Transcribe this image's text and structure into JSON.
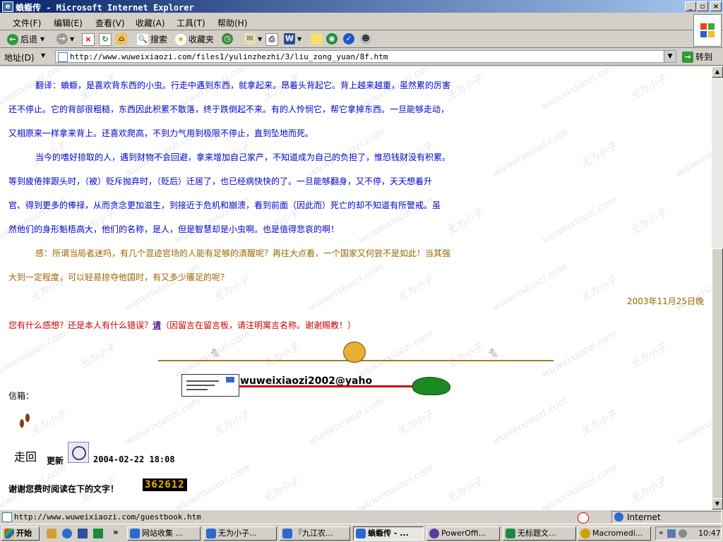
{
  "window": {
    "title": "蝜蝂传 - Microsoft Internet Explorer"
  },
  "menu": [
    "文件(F)",
    "编辑(E)",
    "查看(V)",
    "收藏(A)",
    "工具(T)",
    "帮助(H)"
  ],
  "toolbar": {
    "back": "后退",
    "search": "搜索",
    "favorites": "收藏夹"
  },
  "address": {
    "label": "地址(D)",
    "url": "http://www.wuweixiaozi.com/files1/yulinzhezhi/3/liu_zong_yuan/8f.htm",
    "go": "转到"
  },
  "article": {
    "lines_blue": [
      "翻译：蝜蝂，是喜欢背东西的小虫。行走中遇到东西，就拿起来。昂着头背起它。背上越来越重，虽然累的厉害",
      "还不停止。它的背部很粗糙，东西因此积累不散落，终于跌倒起不来。有的人怜悯它，帮它拿掉东西。一旦能够走动，",
      "又相原来一样拿来背上。还喜欢爬高，不到力气用到极限不停止，直到坠地而死。",
      "当今的嗜好掠取的人，遇到财物不会回避，拿来增加自己家产，不知道成为自己的负担了，惟恐钱财没有积累。",
      "等到疲倦摔跟头时，（被）贬斥抛弃时，（贬后）迁居了，也已经病快快的了。一旦能够翻身，又不停，天天想着升",
      "官、得到更多的俸禄，从而贪念更加滋生，到接近于危机和崩溃，看到前面（因此而）死亡的却不知道有所警戒。虽",
      "然他们的身形魁梧高大，他们的名称，是人，但是智慧却是小虫啊。也是值得悲哀的啊！"
    ],
    "lines_gold": [
      "感：所谓当局者迷吗，有几个混迹官场的人能有足够的清醒呢？再往大点看，一个国家又何尝不是如此！当其强",
      "大到一定程度，可以轻易掠夺他国时，有又多少餍足的呢？"
    ],
    "date": "2003年11月25日晚"
  },
  "feedback": {
    "question": "您有什么感想？还是本人有什么错误？",
    "link": "请",
    "note": "（因留言在留言板，请注明寓言名称。谢谢赐教！）"
  },
  "mailbox": {
    "label": "信箱：",
    "email": "wuweixiaozi2002@yaho"
  },
  "footer": {
    "zou_label": "走回",
    "update_label": "更新",
    "updated": "2004-02-22 18:08",
    "thanks": "谢谢您费时阅读在下的文字！",
    "counter": "362612"
  },
  "watermark": "wuweixiaozi.com",
  "watermark_cn": "无为小子",
  "status": {
    "url": "http://www.wuweixiaozi.com/guestbook.htm",
    "zone": "Internet"
  },
  "taskbar": {
    "start": "开始",
    "items": [
      "网站收集 ...",
      "无为小子...",
      "『九江农...",
      "蝜蝂传 - ...",
      "PowerOffi...",
      "无标题文...",
      "Macromedi..."
    ],
    "clock": "10:47"
  }
}
